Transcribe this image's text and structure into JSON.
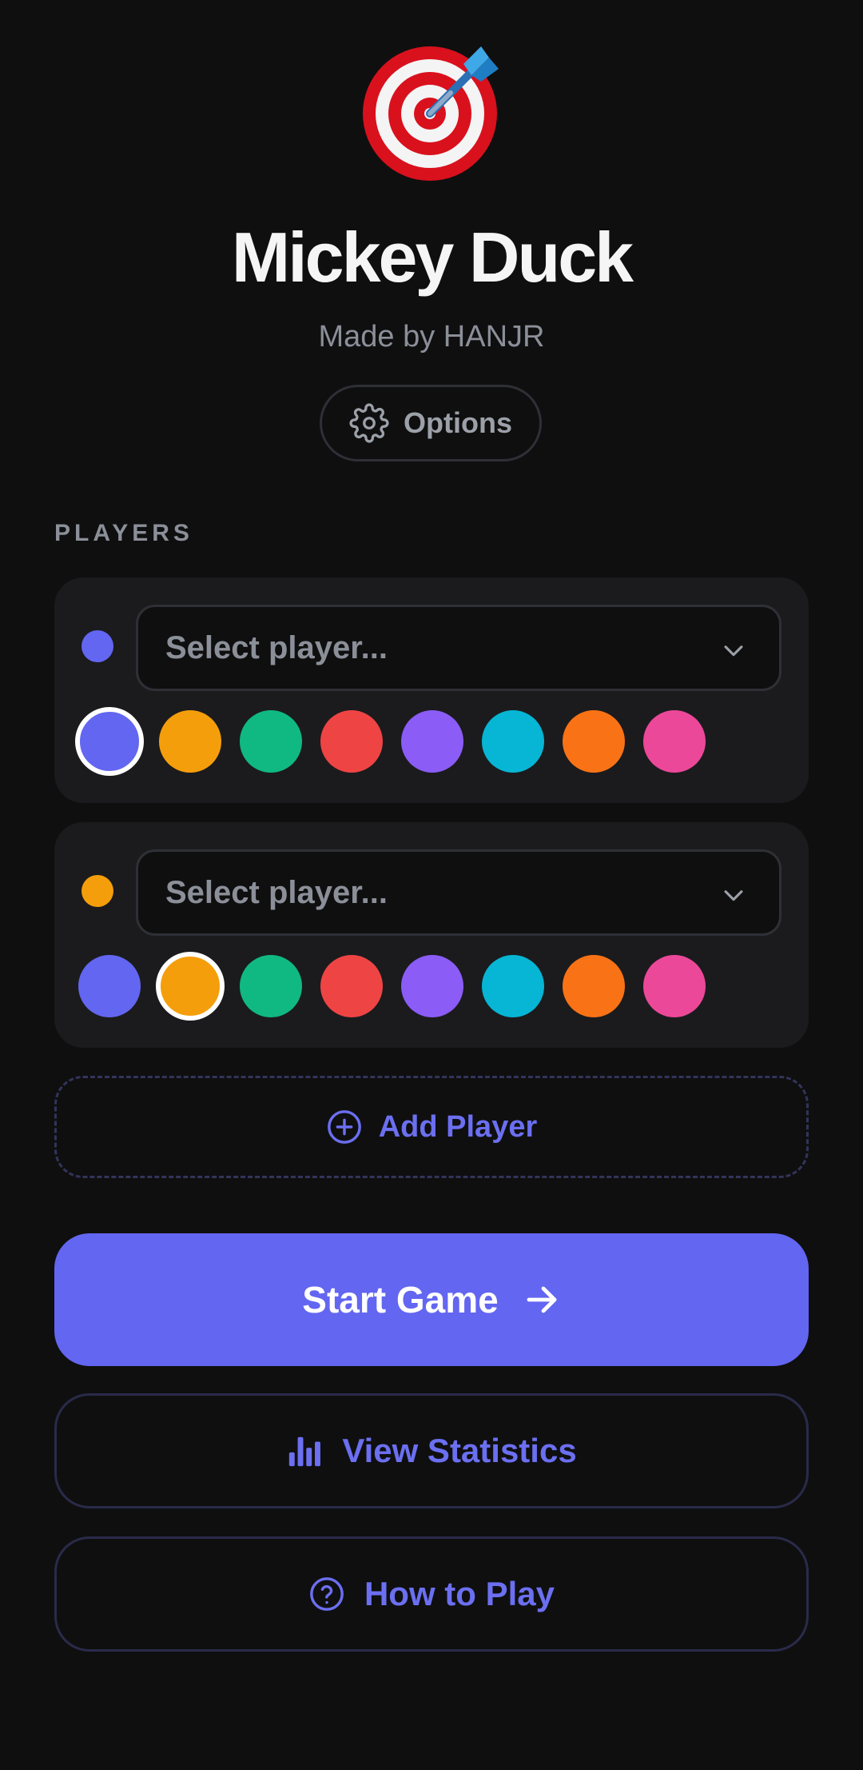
{
  "app": {
    "title": "Mickey Duck",
    "subtitle": "Made by HANJR",
    "logo_icon": "dartboard-icon"
  },
  "options_button": {
    "label": "Options",
    "icon": "gear-icon"
  },
  "players_section": {
    "label": "PLAYERS"
  },
  "players": [
    {
      "placeholder": "Select player...",
      "color": "#6366f1",
      "selected_swatch_index": 0
    },
    {
      "placeholder": "Select player...",
      "color": "#f59e0b",
      "selected_swatch_index": 1
    }
  ],
  "swatch_colors": [
    "#6366f1",
    "#f59e0b",
    "#10b981",
    "#ef4444",
    "#8b5cf6",
    "#06b6d4",
    "#f97316",
    "#ec4899"
  ],
  "add_player": {
    "label": "Add Player",
    "icon": "plus-circle-icon"
  },
  "start_game": {
    "label": "Start Game",
    "icon": "arrow-right-icon"
  },
  "view_statistics": {
    "label": "View Statistics",
    "icon": "bar-chart-icon"
  },
  "how_to_play": {
    "label": "How to Play",
    "icon": "help-circle-icon"
  },
  "colors": {
    "background": "#0f0f10",
    "accent": "#6366f1",
    "card": "#1b1b1d",
    "muted_text": "#8b8f98"
  }
}
